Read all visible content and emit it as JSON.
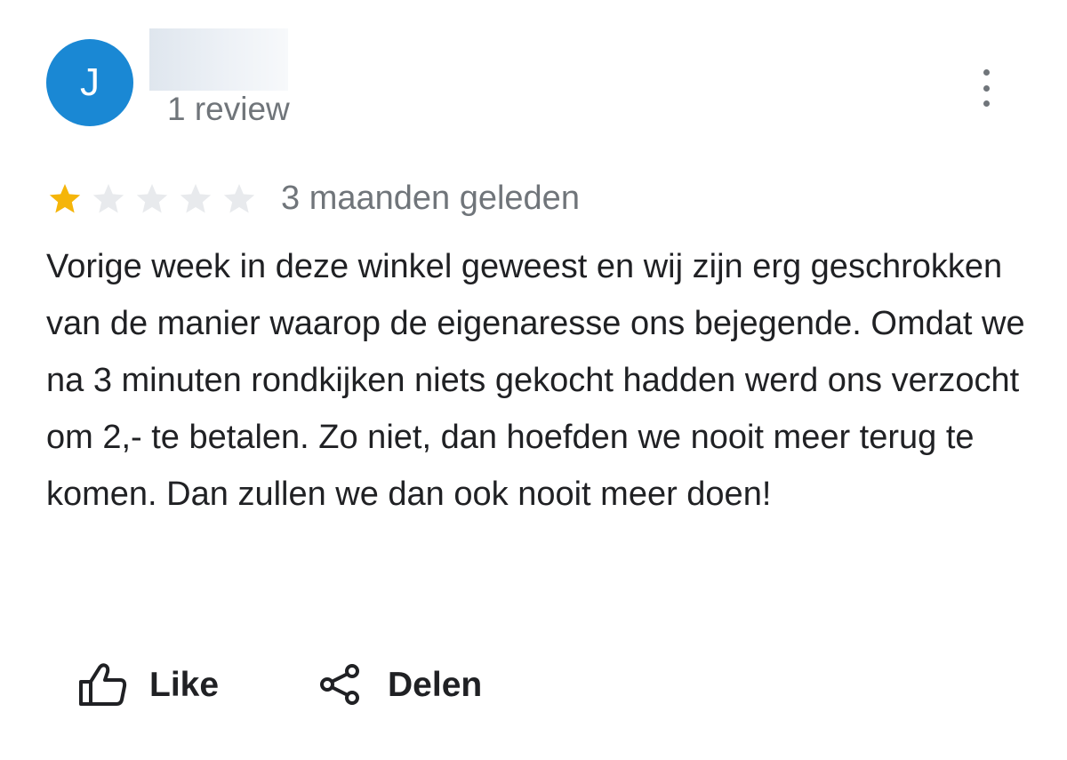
{
  "reviewer": {
    "avatar_letter": "J",
    "review_count": "1 review"
  },
  "rating": {
    "value": 1,
    "max": 5,
    "filled_color": "#f5b50a",
    "empty_color": "#e8eaed"
  },
  "time_ago": "3 maanden geleden",
  "review_text": "Vorige week in deze winkel geweest en wij zijn erg geschrokken van de manier waarop de eigenaresse ons bejegende. Omdat we na 3 minuten rondkijken niets gekocht hadden werd ons verzocht om 2,- te betalen. Zo niet, dan hoefden we nooit meer terug te komen. Dan zullen we dan ook nooit meer doen!",
  "actions": {
    "like_label": "Like",
    "share_label": "Delen"
  },
  "colors": {
    "avatar_bg": "#1a88d4",
    "secondary_text": "#70757a",
    "primary_text": "#202124"
  },
  "icons": {
    "menu": "more-vert-icon",
    "like": "thumb-up-icon",
    "share": "share-icon",
    "star": "star-icon"
  }
}
